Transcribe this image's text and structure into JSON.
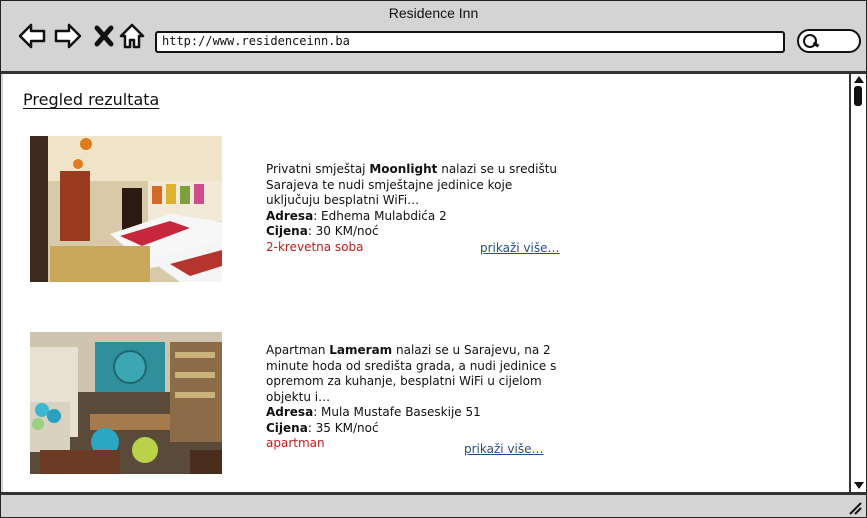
{
  "window": {
    "title": "Residence Inn"
  },
  "toolbar": {
    "back_icon": "back-arrow-icon",
    "forward_icon": "forward-arrow-icon",
    "close_icon": "close-x-icon",
    "home_icon": "home-icon",
    "url": "http://www.residenceinn.ba",
    "search_icon": "search-icon"
  },
  "page": {
    "heading": "Pregled rezultata",
    "results": [
      {
        "intro": "Privatni smještaj ",
        "name": "Moonlight",
        "description": " nalazi se u središtu Sarajeva te nudi smještajne jedinice koje uključuju besplatni WiFi…",
        "address_label": "Adresa",
        "address": ": Edhema Mulabdića 2",
        "price_label": "Cijena",
        "price": ": 30 KM/noć",
        "type": "2-krevetna soba",
        "more_label": "prikaži više…"
      },
      {
        "intro": "Apartman ",
        "name": "Lameram",
        "description": " nalazi se u Sarajevu, na 2 minute hoda od središta grada, a nudi jedinice s opremom za kuhanje, besplatni WiFi u cijelom objektu i…",
        "address_label": "Adresa",
        "address": ": Mula Mustafe Baseskije 51",
        "price_label": "Cijena",
        "price": ": 35 KM/noć",
        "type": "apartman",
        "more_label": "prikaži više…"
      }
    ]
  },
  "colors": {
    "type_text": "#c41b1b",
    "link": "#1f4f8a",
    "chrome": "#d4d4d4"
  }
}
